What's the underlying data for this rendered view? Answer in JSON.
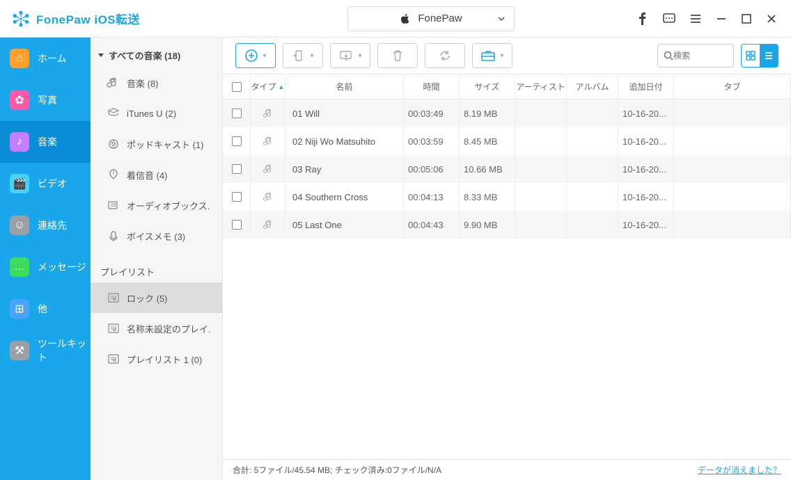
{
  "app_title": "FonePaw iOS転送",
  "device_name": "FonePaw",
  "search_placeholder": "検索",
  "rail": [
    {
      "key": "home",
      "label": "ホーム",
      "bg": "#ff9f2e",
      "glyph": "⌂"
    },
    {
      "key": "photos",
      "label": "写真",
      "bg": "#ff5aa6",
      "glyph": "✿"
    },
    {
      "key": "music",
      "label": "音楽",
      "bg": "#c77dff",
      "glyph": "♪"
    },
    {
      "key": "video",
      "label": "ビデオ",
      "bg": "#47d1ff",
      "glyph": "🎬"
    },
    {
      "key": "contacts",
      "label": "連絡先",
      "bg": "#9aa0a6",
      "glyph": "☺"
    },
    {
      "key": "messages",
      "label": "メッセージ",
      "bg": "#3ddc5c",
      "glyph": "…"
    },
    {
      "key": "other",
      "label": "他",
      "bg": "#4aa3ff",
      "glyph": "⊞"
    },
    {
      "key": "toolkit",
      "label": "ツールキット",
      "bg": "#9aa0a6",
      "glyph": "⚒"
    }
  ],
  "rail_selected": "music",
  "tree_header": "すべての音楽 (18)",
  "tree_items": [
    {
      "label": "音楽 (8)"
    },
    {
      "label": "iTunes U (2)"
    },
    {
      "label": "ポッドキャスト (1)"
    },
    {
      "label": "着信音 (4)"
    },
    {
      "label": "オーディオブックス."
    },
    {
      "label": "ボイスメモ (3)"
    }
  ],
  "playlist_header": "プレイリスト",
  "playlists": [
    {
      "label": "ロック (5)",
      "selected": true
    },
    {
      "label": "名称未設定のプレイ."
    },
    {
      "label": "プレイリスト 1 (0)"
    }
  ],
  "columns": {
    "type": "タイプ",
    "name": "名前",
    "time": "時間",
    "size": "サイズ",
    "artist": "アーティスト",
    "album": "アルバム",
    "date": "追加日付",
    "tab": "タブ"
  },
  "rows": [
    {
      "name": "01 Will",
      "time": "00:03:49",
      "size": "8.19 MB",
      "artist": "",
      "album": "",
      "date": "10-16-20..."
    },
    {
      "name": "02 Niji Wo Matsuhito",
      "time": "00:03:59",
      "size": "8.45 MB",
      "artist": "",
      "album": "",
      "date": "10-16-20..."
    },
    {
      "name": "03 Ray",
      "time": "00:05:06",
      "size": "10.66 MB",
      "artist": "",
      "album": "",
      "date": "10-16-20..."
    },
    {
      "name": "04 Southern Cross",
      "time": "00:04:13",
      "size": "8.33 MB",
      "artist": "",
      "album": "",
      "date": "10-16-20..."
    },
    {
      "name": "05 Last One",
      "time": "00:04:43",
      "size": "9.90 MB",
      "artist": "",
      "album": "",
      "date": "10-16-20..."
    }
  ],
  "status_text": "合計: 5ファイル/45.54 MB; チェック済み:0ファイル/N/A",
  "missing_link": "データが消えました？"
}
